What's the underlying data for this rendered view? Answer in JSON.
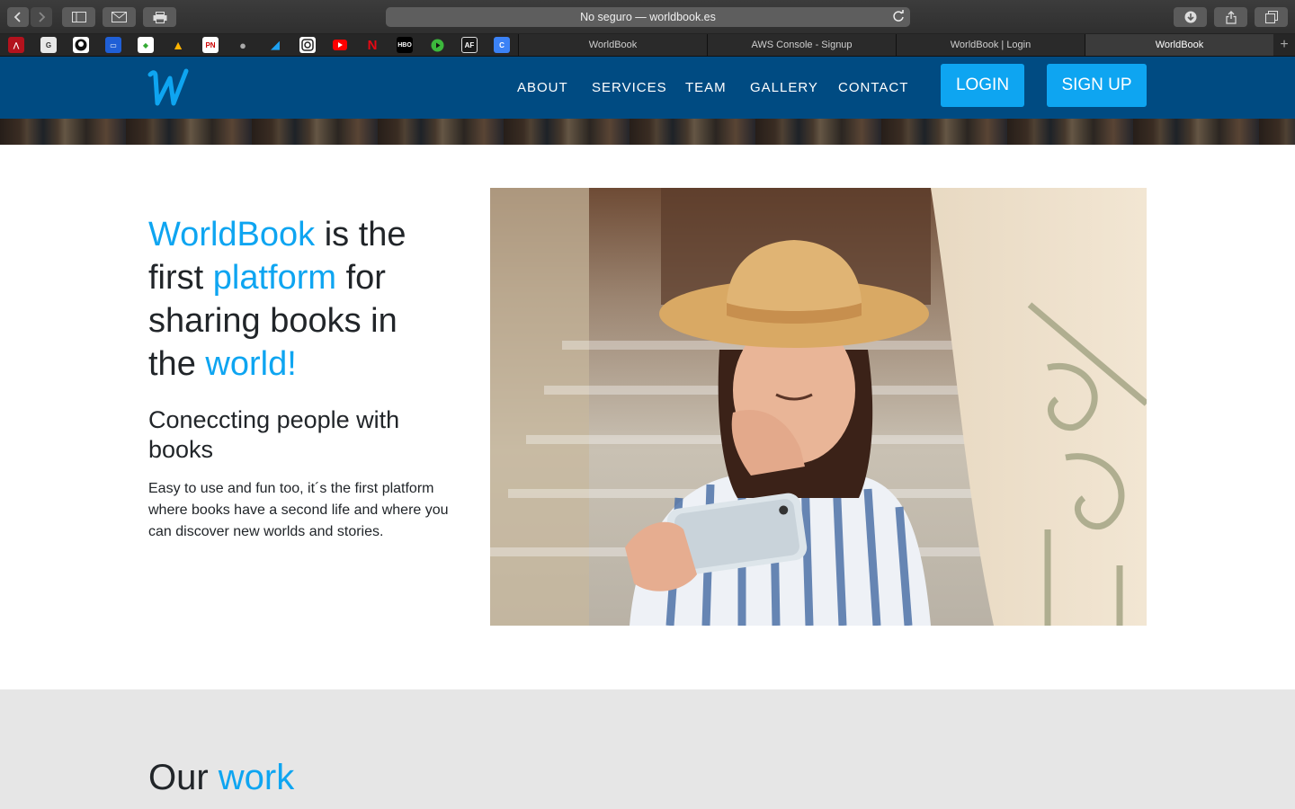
{
  "browser": {
    "url_text": "No seguro — worldbook.es",
    "tabs": [
      {
        "label": "WorldBook",
        "active": false
      },
      {
        "label": "AWS Console - Signup",
        "active": false
      },
      {
        "label": "WorldBook | Login",
        "active": false
      },
      {
        "label": "WorldBook",
        "active": true
      }
    ],
    "favorites": [
      "bookmark-1-icon",
      "bookmark-2-icon",
      "github-icon",
      "bookmark-4-icon",
      "bookmark-5-icon",
      "firebase-icon",
      "bookmark-pn-icon",
      "apple-icon",
      "twitter-icon",
      "instagram-icon",
      "youtube-icon",
      "netflix-icon",
      "hbo-icon",
      "play-icon",
      "af-icon",
      "bookmark-16-icon"
    ],
    "favorite_labels": {
      "pn": "PN",
      "hbo": "HBO",
      "af": "AF"
    }
  },
  "navbar": {
    "logo_letter": "W",
    "links": [
      "ABOUT",
      "SERVICES",
      "TEAM",
      "GALLERY",
      "CONTACT"
    ],
    "login_label": "LOGIN",
    "signup_label": "SIGN UP"
  },
  "hero": {
    "headline": {
      "w1": "WorldBook",
      "w2": " is the first ",
      "w3": "platform",
      "w4": " for sharing books in the ",
      "w5": "world!"
    },
    "subheading": "Coneccting people with books",
    "paragraph": "Easy to use and fun too, it´s the first platform where books have a second life and where you can discover new worlds and stories."
  },
  "work": {
    "title_plain": "Our ",
    "title_accent": "work"
  },
  "colors": {
    "navbar": "#004b82",
    "accent": "#0ea5f1",
    "text": "#212529",
    "section_gray": "#e6e6e6"
  }
}
